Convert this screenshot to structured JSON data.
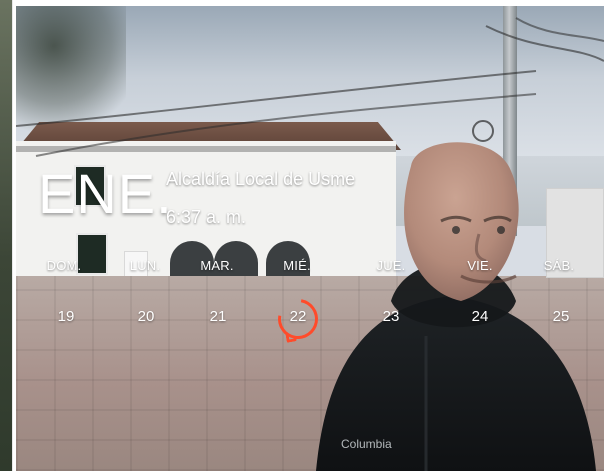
{
  "lockscreen": {
    "month_abbrev": "ENE.",
    "location": "Alcaldía Local de Usme",
    "time": "6:37 a. m.",
    "weekdays": [
      "DOM.",
      "LUN.",
      "MAR.",
      "MIÉ.",
      "JUE.",
      "VIE.",
      "SÁB."
    ],
    "dates": [
      "19",
      "20",
      "21",
      "22",
      "23",
      "24",
      "25"
    ],
    "today": "22",
    "accent_color": "#ff4b2b"
  },
  "background_photo": {
    "jacket_brand_text": "Columbia"
  }
}
